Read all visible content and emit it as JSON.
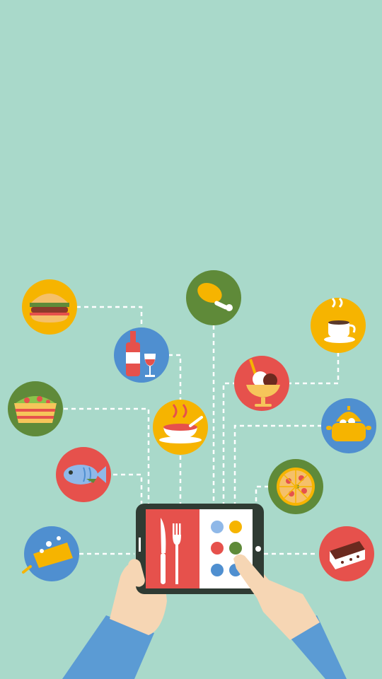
{
  "theme": {
    "background": "#a9d9ca",
    "connector": "#ffffff",
    "tablet_frame": "#2f3b33",
    "menu_left": "#e6514c",
    "menu_right": "#ffffff",
    "sleeve": "#5b9bd4",
    "skin": "#f6d6b4"
  },
  "icons": [
    {
      "name": "burger-icon",
      "bg": "#f6b400"
    },
    {
      "name": "chicken-leg-icon",
      "bg": "#5f8a39"
    },
    {
      "name": "coffee-cup-icon",
      "bg": "#f6b400"
    },
    {
      "name": "wine-icon",
      "bg": "#4f8fd0"
    },
    {
      "name": "ice-cream-icon",
      "bg": "#e6514c"
    },
    {
      "name": "salad-bowl-icon",
      "bg": "#5f8a39"
    },
    {
      "name": "soup-bowl-icon",
      "bg": "#f6b400"
    },
    {
      "name": "cooking-pot-icon",
      "bg": "#4f8fd0"
    },
    {
      "name": "fish-icon",
      "bg": "#e6514c"
    },
    {
      "name": "pizza-icon",
      "bg": "#5f8a39"
    },
    {
      "name": "paella-pan-icon",
      "bg": "#4f8fd0"
    },
    {
      "name": "cake-slice-icon",
      "bg": "#e6514c"
    }
  ],
  "tablet": {
    "menu_dots": [
      "#8fb8e8",
      "#f6b400",
      "#e6514c",
      "#5f8a39",
      "#4f8fd0",
      "#4f8fd0"
    ]
  }
}
